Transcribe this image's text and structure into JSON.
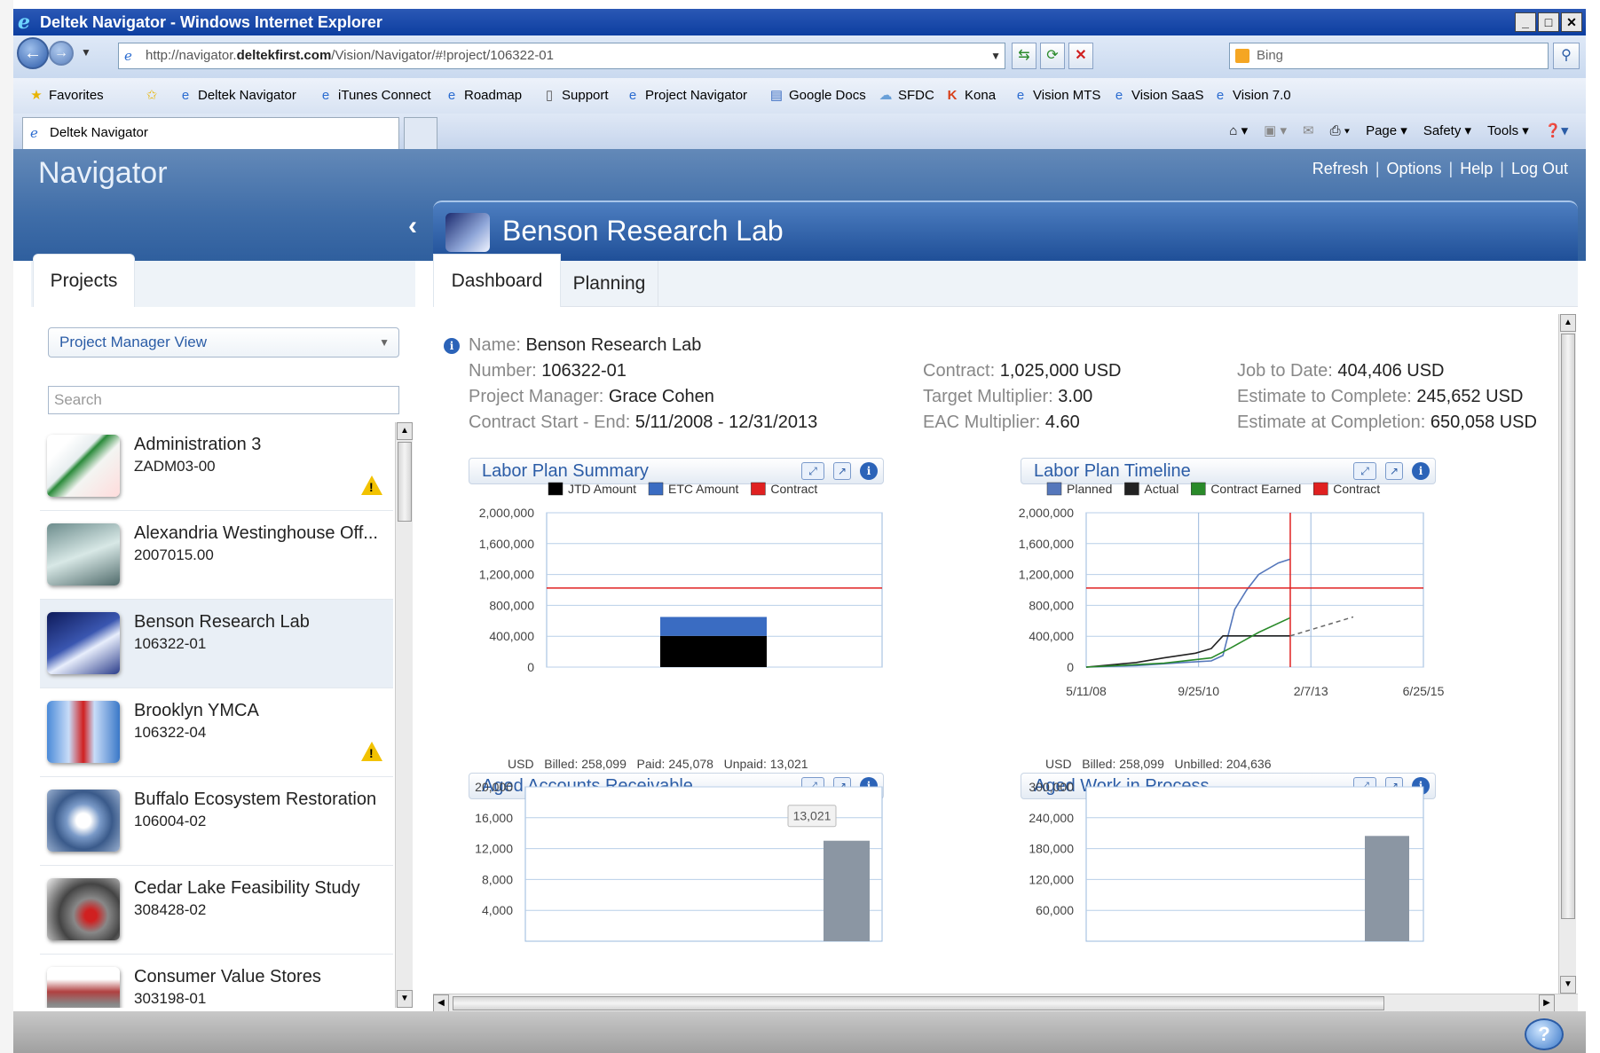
{
  "browser": {
    "window_title": "Deltek Navigator - Windows Internet Explorer",
    "url_prefix": "http://navigator.",
    "url_domain": "deltekfirst.com",
    "url_path": "/Vision/Navigator/#!project/106322-01",
    "search_placeholder": "Bing",
    "favorites_label": "Favorites",
    "favorites": [
      "Deltek Navigator",
      "iTunes Connect",
      "Roadmap",
      "Support",
      "Project Navigator",
      "Google Docs",
      "SFDC",
      "Kona",
      "Vision MTS",
      "Vision SaaS",
      "Vision 7.0"
    ],
    "tab_label": "Deltek Navigator",
    "commands": [
      "Page",
      "Safety",
      "Tools"
    ]
  },
  "app": {
    "title": "Navigator",
    "links": [
      "Refresh",
      "Options",
      "Help",
      "Log Out"
    ],
    "link_sep": "|"
  },
  "left": {
    "tab": "Projects",
    "view_select": "Project Manager View",
    "search_placeholder": "Search",
    "projects": [
      {
        "name": "Administration 3",
        "number": "ZADM03-00",
        "warning": true
      },
      {
        "name": "Alexandria Westinghouse Off...",
        "number": "2007015.00",
        "warning": false
      },
      {
        "name": "Benson Research Lab",
        "number": "106322-01",
        "warning": false,
        "selected": true
      },
      {
        "name": "Brooklyn YMCA",
        "number": "106322-04",
        "warning": true
      },
      {
        "name": "Buffalo Ecosystem Restoration",
        "number": "106004-02",
        "warning": false
      },
      {
        "name": "Cedar Lake Feasibility Study",
        "number": "308428-02",
        "warning": false
      },
      {
        "name": "Consumer Value Stores",
        "number": "303198-01",
        "warning": false
      }
    ]
  },
  "project": {
    "title": "Benson Research Lab",
    "tabs": [
      "Dashboard",
      "Planning"
    ],
    "fields": {
      "name_label": "Name:",
      "name": "Benson Research Lab",
      "number_label": "Number:",
      "number": "106322-01",
      "pm_label": "Project Manager:",
      "pm": "Grace Cohen",
      "dates_label": "Contract Start - End:",
      "dates": "5/11/2008 - 12/31/2013",
      "contract_label": "Contract:",
      "contract": "1,025,000 USD",
      "target_mult_label": "Target Multiplier:",
      "target_mult": "3.00",
      "eac_mult_label": "EAC Multiplier:",
      "eac_mult": "4.60",
      "jtd_label": "Job to Date:",
      "jtd": "404,406 USD",
      "etc_label": "Estimate to Complete:",
      "etc": "245,652 USD",
      "eac_label": "Estimate at Completion:",
      "eac": "650,058 USD"
    }
  },
  "widgets": {
    "labor_summary": {
      "title": "Labor Plan Summary"
    },
    "labor_timeline": {
      "title": "Labor Plan Timeline"
    },
    "aged_ar": {
      "title": "Aged Accounts Receivable",
      "summary": "USD   Billed: 258,099   Paid: 245,078   Unpaid: 13,021"
    },
    "aged_wip": {
      "title": "Aged Work in Process",
      "summary": "USD   Billed: 258,099   Unbilled: 204,636"
    }
  },
  "chart_data": [
    {
      "type": "bar",
      "title": "Labor Plan Summary",
      "series": [
        {
          "name": "JTD Amount",
          "values": [
            404406
          ],
          "color": "#000000"
        },
        {
          "name": "ETC Amount",
          "values": [
            245652
          ],
          "color": "#3a6cc2"
        },
        {
          "name": "Contract",
          "values": [
            1025000
          ],
          "color": "#e02020"
        }
      ],
      "stacked": true,
      "ylim": [
        0,
        2000000
      ],
      "yticks": [
        "0",
        "400,000",
        "800,000",
        "1,200,000",
        "1,600,000",
        "2,000,000"
      ],
      "ytick_values": [
        0,
        400000,
        800000,
        1200000,
        1600000,
        2000000
      ],
      "legend_position": "top",
      "grid": true
    },
    {
      "type": "line",
      "title": "Labor Plan Timeline",
      "xticks": [
        "5/11/08",
        "9/25/10",
        "2/7/13",
        "6/25/15"
      ],
      "xlim": [
        "2008-05-11",
        "2015-06-25"
      ],
      "ylim": [
        0,
        2000000
      ],
      "yticks": [
        "0",
        "400,000",
        "800,000",
        "1,200,000",
        "1,600,000",
        "2,000,000"
      ],
      "ytick_values": [
        0,
        400000,
        800000,
        1200000,
        1600000,
        2000000
      ],
      "series": [
        {
          "name": "Planned",
          "color": "#5577bb",
          "x": [
            "2008-05-11",
            "2009-06-01",
            "2010-06-01",
            "2011-01-01",
            "2011-04-01",
            "2011-07-01",
            "2011-10-01",
            "2012-01-01",
            "2012-06-01",
            "2012-09-01"
          ],
          "y": [
            0,
            20000,
            60000,
            80000,
            150000,
            750000,
            1000000,
            1200000,
            1350000,
            1400000
          ]
        },
        {
          "name": "Actual",
          "color": "#222222",
          "x": [
            "2008-05-11",
            "2009-06-01",
            "2010-01-01",
            "2010-09-01",
            "2011-01-01",
            "2011-04-01",
            "2012-09-01"
          ],
          "y": [
            0,
            60000,
            120000,
            180000,
            240000,
            404406,
            404406
          ]
        },
        {
          "name": "Contract Earned",
          "color": "#2a8a2a",
          "x": [
            "2008-05-11",
            "2010-01-01",
            "2011-01-01",
            "2011-06-01",
            "2012-01-01",
            "2012-09-01"
          ],
          "y": [
            0,
            50000,
            120000,
            250000,
            450000,
            640000
          ]
        },
        {
          "name": "Contract",
          "color": "#e02020",
          "constant": 1025000
        }
      ],
      "marker_date": "2012-09-01",
      "projection": {
        "x": [
          "2012-09-01",
          "2013-12-31"
        ],
        "y": [
          404406,
          650058
        ]
      },
      "legend_position": "top",
      "grid": true
    },
    {
      "type": "bar",
      "title": "Aged Accounts Receivable",
      "values": [
        13021
      ],
      "data_labels": [
        "13,021"
      ],
      "ylim": [
        0,
        20000
      ],
      "yticks": [
        "4,000",
        "8,000",
        "12,000",
        "16,000",
        "20,000"
      ],
      "ytick_values": [
        4000,
        8000,
        12000,
        16000,
        20000
      ],
      "grid": true
    },
    {
      "type": "bar",
      "title": "Aged Work in Process",
      "values": [
        204636
      ],
      "ylim": [
        0,
        300000
      ],
      "yticks": [
        "60,000",
        "120,000",
        "180,000",
        "240,000",
        "300,000"
      ],
      "ytick_values": [
        60000,
        120000,
        180000,
        240000,
        300000
      ],
      "grid": true
    }
  ]
}
